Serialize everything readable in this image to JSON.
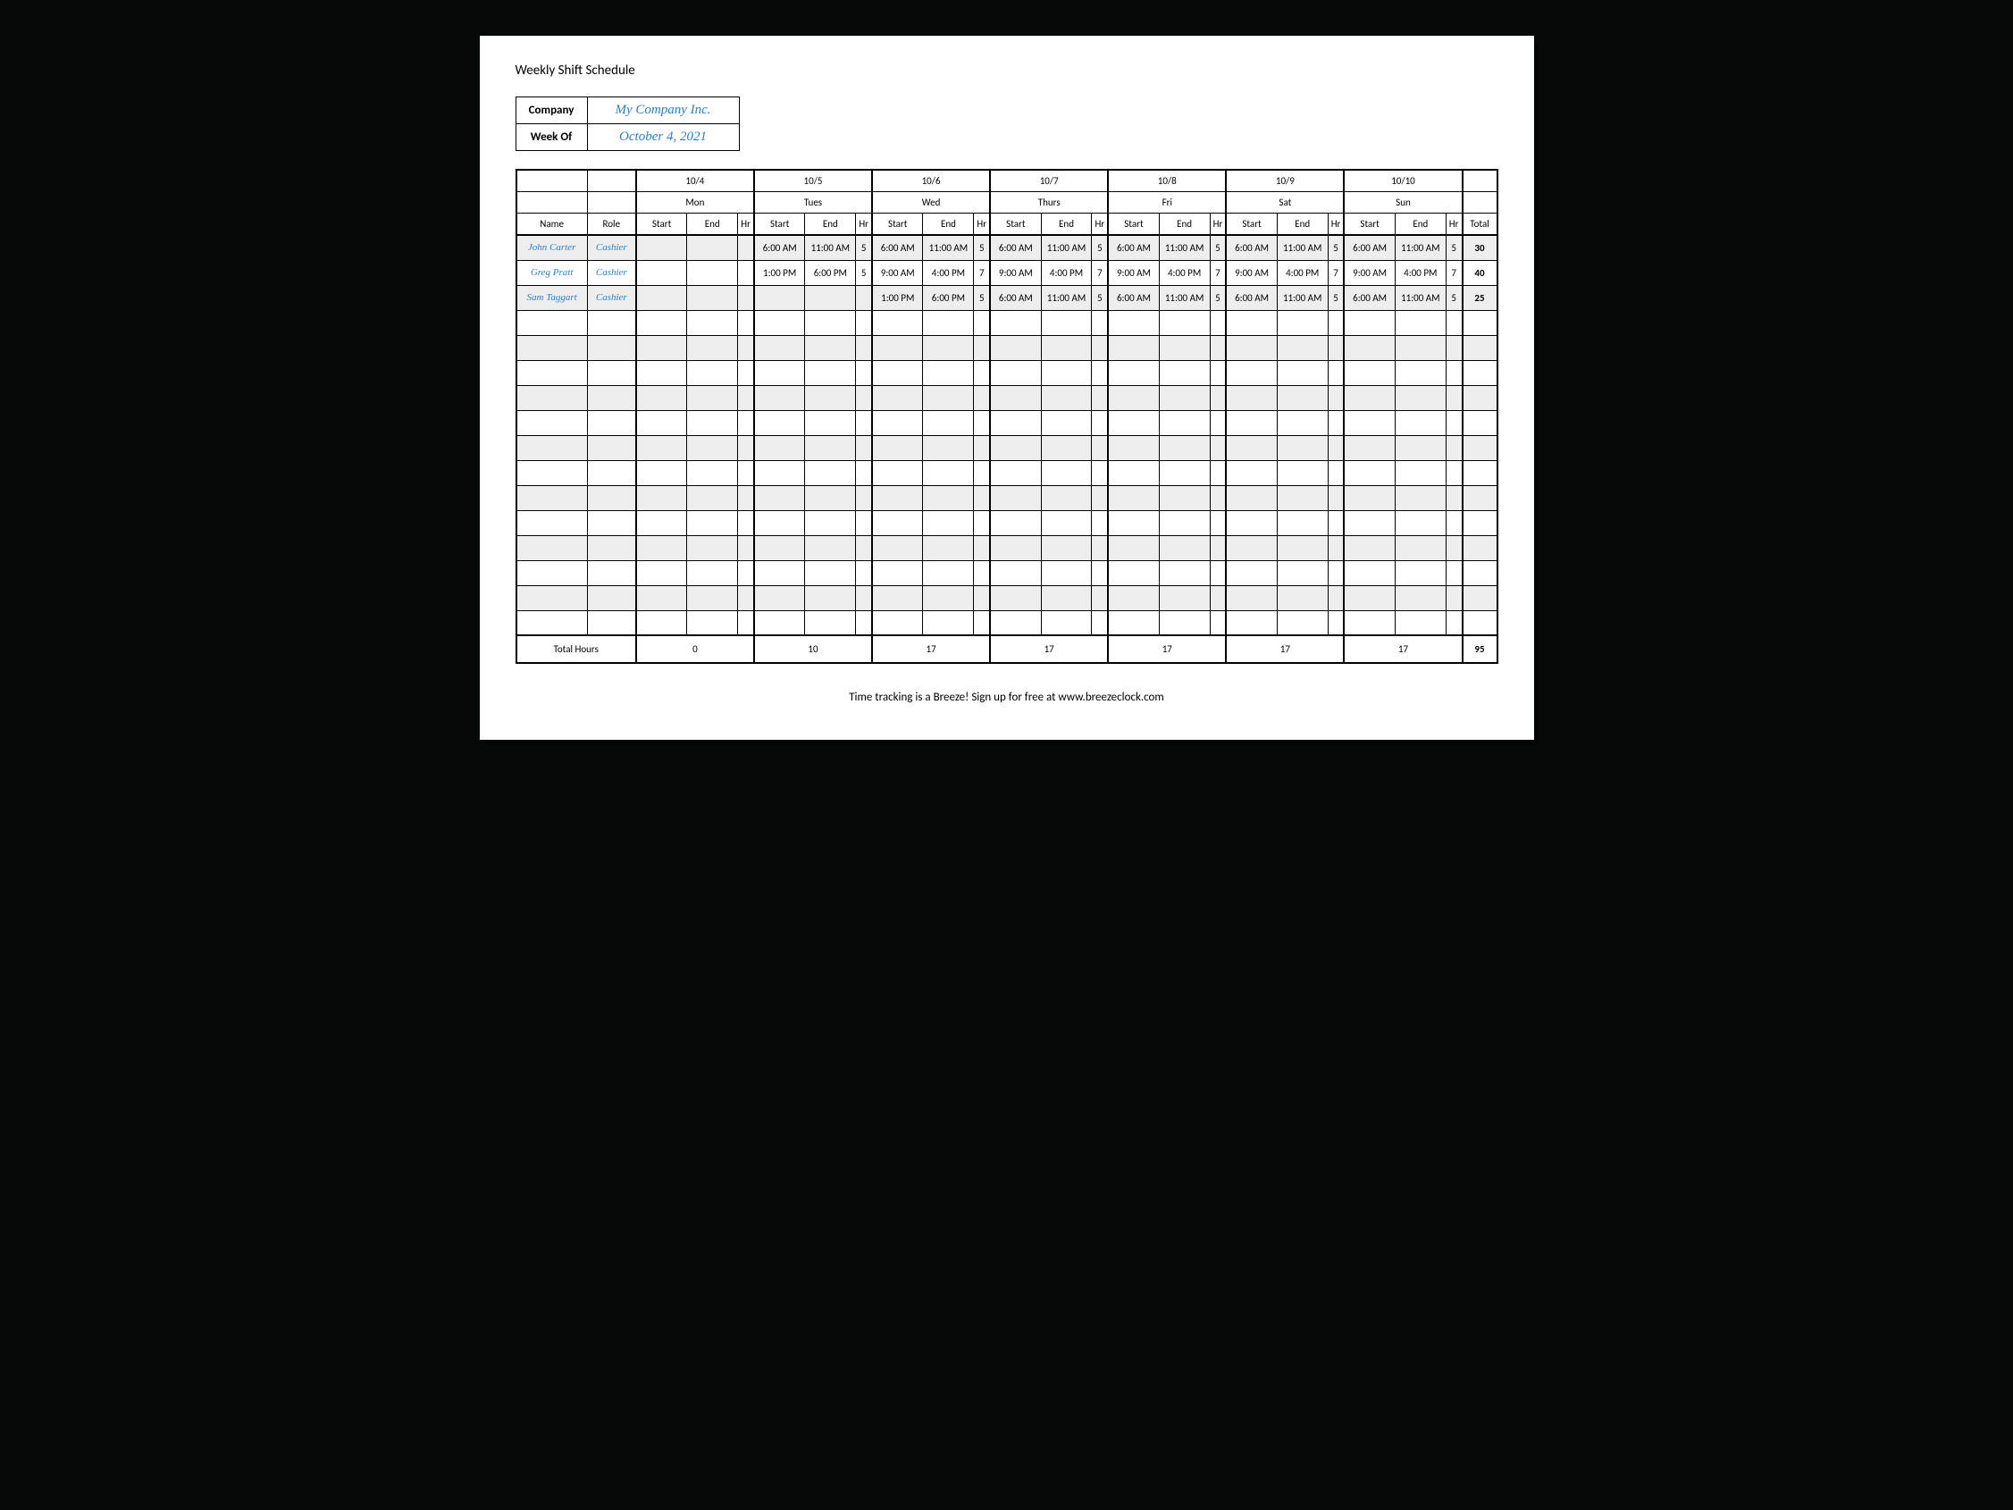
{
  "title": "Weekly Shift Schedule",
  "company_label": "Company",
  "company_value": "My Company Inc.",
  "week_label": "Week Of",
  "week_value": "October 4, 2021",
  "dates": [
    "10/4",
    "10/5",
    "10/6",
    "10/7",
    "10/8",
    "10/9",
    "10/10"
  ],
  "days": [
    "Mon",
    "Tues",
    "Wed",
    "Thurs",
    "Fri",
    "Sat",
    "Sun"
  ],
  "col_name": "Name",
  "col_role": "Role",
  "col_start": "Start",
  "col_end": "End",
  "col_hr": "Hr",
  "col_total": "Total",
  "employees": [
    {
      "name": "John Carter",
      "role": "Cashier",
      "shifts": [
        {
          "start": "",
          "end": "",
          "hr": ""
        },
        {
          "start": "6:00 AM",
          "end": "11:00 AM",
          "hr": "5"
        },
        {
          "start": "6:00 AM",
          "end": "11:00 AM",
          "hr": "5"
        },
        {
          "start": "6:00 AM",
          "end": "11:00 AM",
          "hr": "5"
        },
        {
          "start": "6:00 AM",
          "end": "11:00 AM",
          "hr": "5"
        },
        {
          "start": "6:00 AM",
          "end": "11:00 AM",
          "hr": "5"
        },
        {
          "start": "6:00 AM",
          "end": "11:00 AM",
          "hr": "5"
        }
      ],
      "total": "30"
    },
    {
      "name": "Greg Pratt",
      "role": "Cashier",
      "shifts": [
        {
          "start": "",
          "end": "",
          "hr": ""
        },
        {
          "start": "1:00 PM",
          "end": "6:00 PM",
          "hr": "5"
        },
        {
          "start": "9:00 AM",
          "end": "4:00 PM",
          "hr": "7"
        },
        {
          "start": "9:00 AM",
          "end": "4:00 PM",
          "hr": "7"
        },
        {
          "start": "9:00 AM",
          "end": "4:00 PM",
          "hr": "7"
        },
        {
          "start": "9:00 AM",
          "end": "4:00 PM",
          "hr": "7"
        },
        {
          "start": "9:00 AM",
          "end": "4:00 PM",
          "hr": "7"
        }
      ],
      "total": "40"
    },
    {
      "name": "Sam Taggart",
      "role": "Cashier",
      "shifts": [
        {
          "start": "",
          "end": "",
          "hr": ""
        },
        {
          "start": "",
          "end": "",
          "hr": ""
        },
        {
          "start": "1:00 PM",
          "end": "6:00 PM",
          "hr": "5"
        },
        {
          "start": "6:00 AM",
          "end": "11:00 AM",
          "hr": "5"
        },
        {
          "start": "6:00 AM",
          "end": "11:00 AM",
          "hr": "5"
        },
        {
          "start": "6:00 AM",
          "end": "11:00 AM",
          "hr": "5"
        },
        {
          "start": "6:00 AM",
          "end": "11:00 AM",
          "hr": "5"
        }
      ],
      "total": "25"
    }
  ],
  "empty_rows": 13,
  "total_hours_label": "Total Hours",
  "day_totals": [
    "0",
    "10",
    "17",
    "17",
    "17",
    "17",
    "17"
  ],
  "grand_total": "95",
  "footer": "Time tracking is a Breeze! Sign up for free at www.breezeclock.com"
}
